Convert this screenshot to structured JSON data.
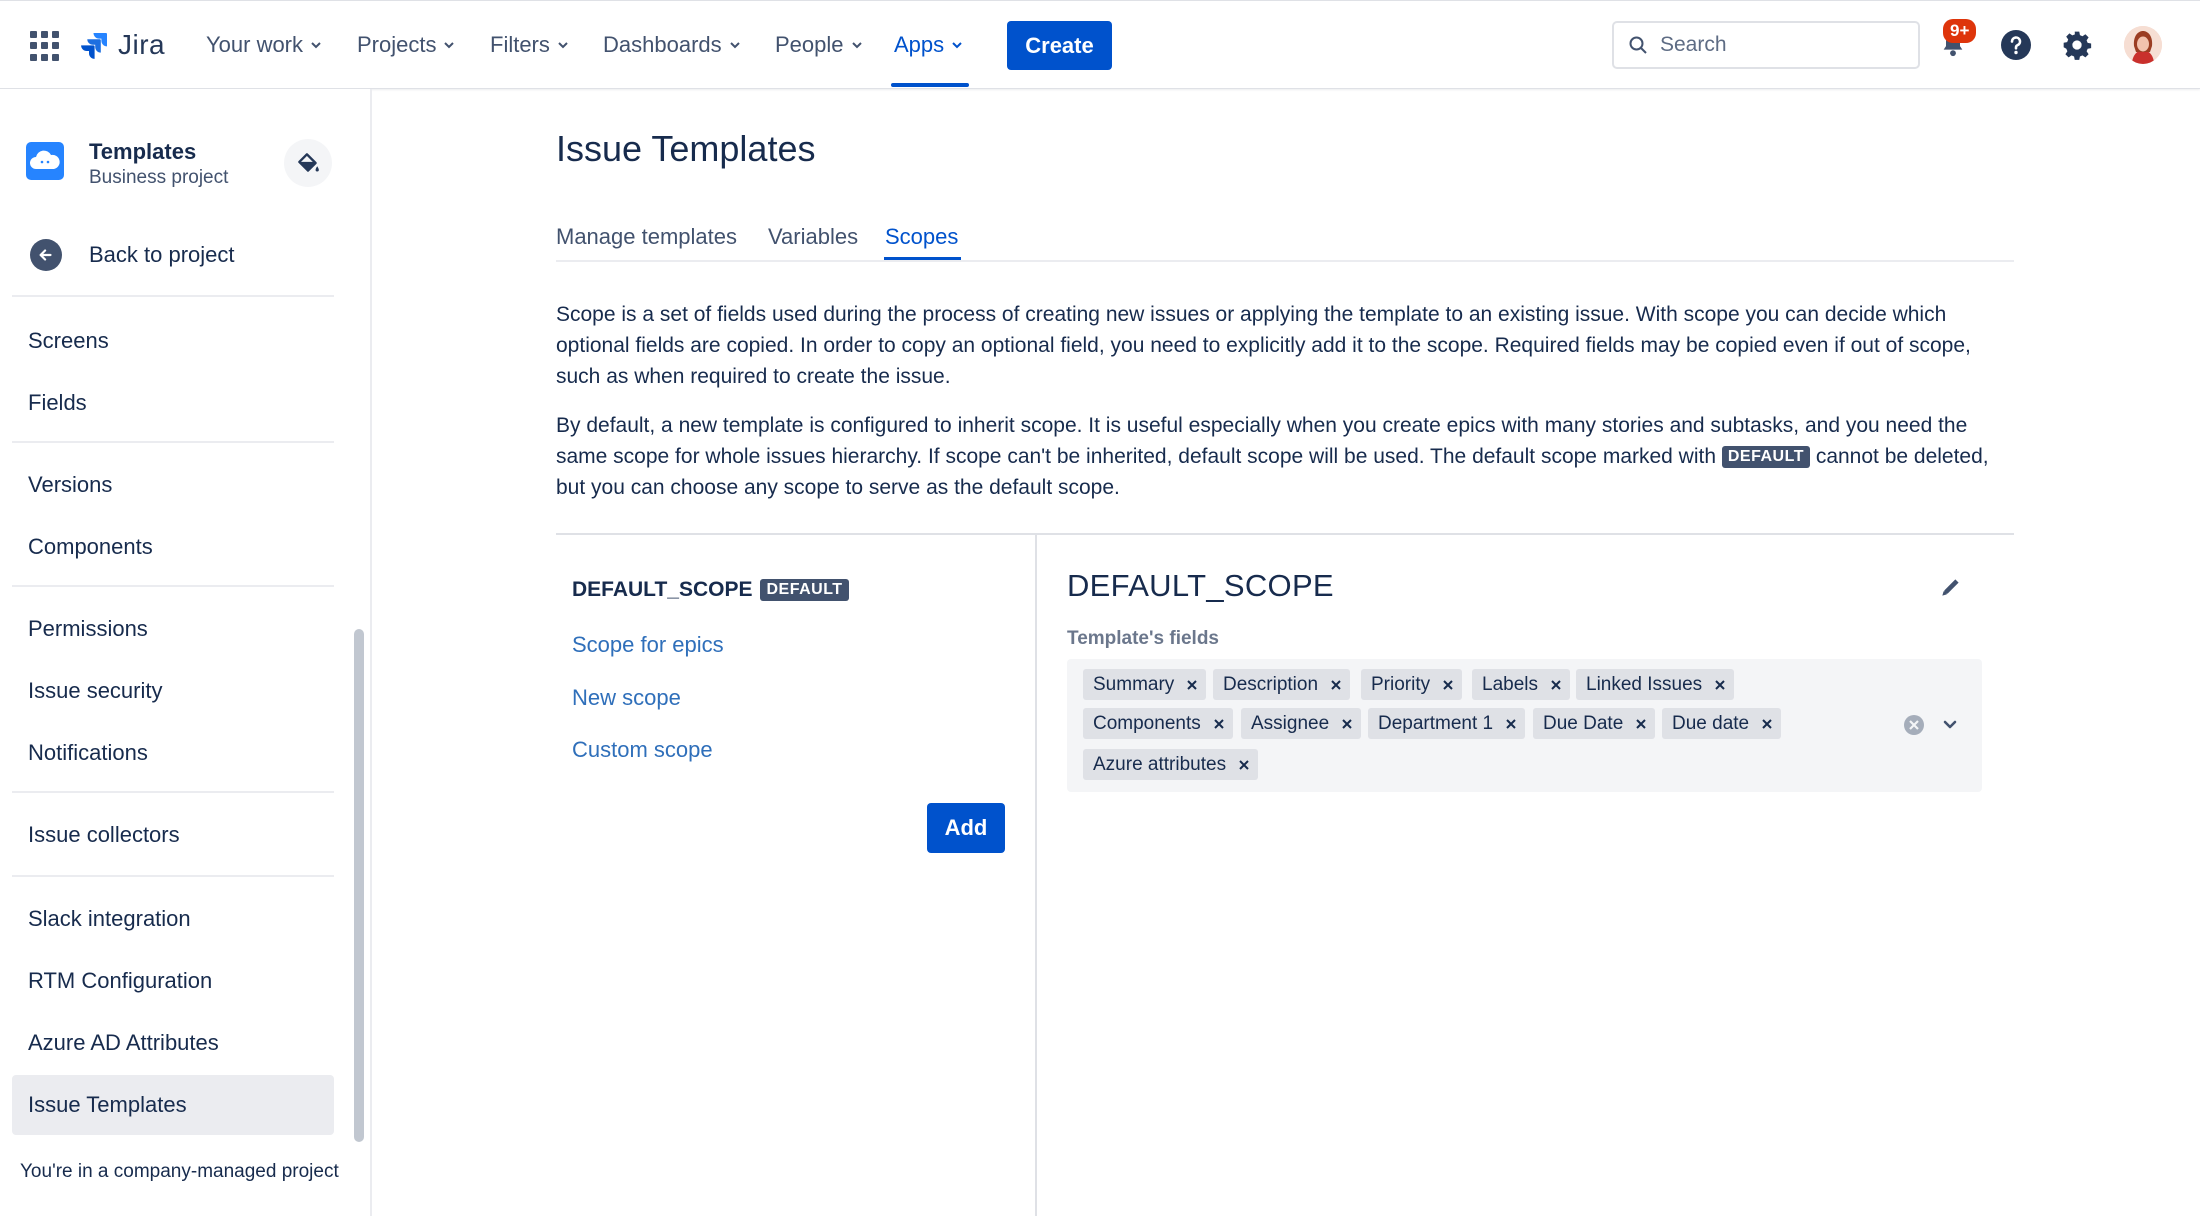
{
  "topnav": {
    "logo_text": "Jira",
    "items": [
      "Your work",
      "Projects",
      "Filters",
      "Dashboards",
      "People",
      "Apps"
    ],
    "create_label": "Create",
    "search_placeholder": "Search",
    "notification_badge": "9+"
  },
  "sidebar": {
    "project_name": "Templates",
    "project_type": "Business project",
    "back_label": "Back to project",
    "items": [
      "Screens",
      "Fields",
      "Versions",
      "Components",
      "Permissions",
      "Issue security",
      "Notifications",
      "Issue collectors",
      "Slack integration",
      "RTM Configuration",
      "Azure AD Attributes",
      "Issue Templates"
    ],
    "selected": "Issue Templates",
    "footer": "You're in a company-managed project"
  },
  "main": {
    "title": "Issue Templates",
    "tabs": [
      "Manage templates",
      "Variables",
      "Scopes"
    ],
    "active_tab": "Scopes",
    "paragraph1": "Scope is a set of fields used during the process of creating new issues or applying the template to an existing issue. With scope you can decide which optional fields are copied. In order to copy an optional field, you need to explicitly add it to the scope. Required fields may be copied even if out of scope, such as when required to create the issue.",
    "paragraph2_before": "By default, a new template is configured to inherit scope. It is useful especially when you create epics with many stories and subtasks, and you need the same scope for whole issues hierarchy. If scope can't be inherited, default scope will be used. The default scope marked with",
    "paragraph2_lozenge": "DEFAULT",
    "paragraph2_after": "cannot be deleted, but you can choose any scope to serve as the default scope.",
    "scopes": {
      "default_name": "DEFAULT_SCOPE",
      "default_lozenge": "DEFAULT",
      "links": [
        "Scope for epics",
        "New scope",
        "Custom scope"
      ],
      "add_label": "Add"
    },
    "detail": {
      "title": "DEFAULT_SCOPE",
      "fields_label": "Template's fields",
      "fields": [
        "Summary",
        "Description",
        "Priority",
        "Labels",
        "Linked Issues",
        "Components",
        "Assignee",
        "Department 1",
        "Due Date",
        "Due date",
        "Azure attributes"
      ]
    }
  },
  "colors": {
    "primary": "#0052CC",
    "text": "#172B4D",
    "badge": "#DE350B",
    "lozenge": "#42526E"
  }
}
